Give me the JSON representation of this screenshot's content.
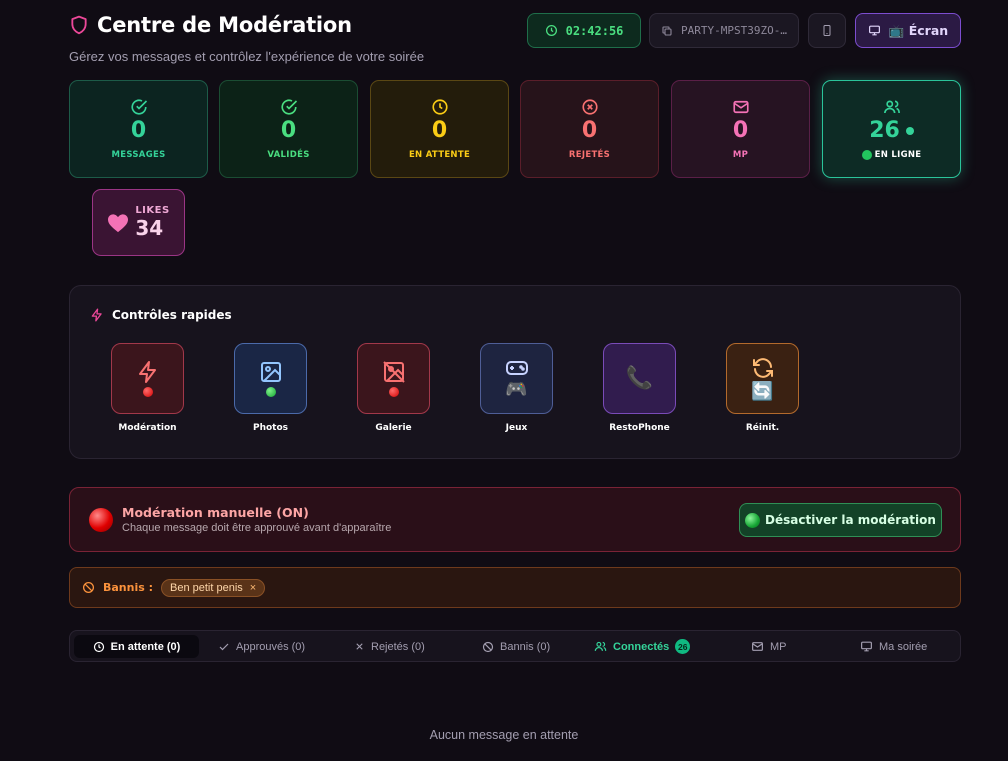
{
  "header": {
    "title": "Centre de Modération",
    "subtitle": "Gérez vos messages et contrôlez l'expérience de votre soirée",
    "timer": "02:42:56",
    "party_code": "PARTY-MPST39ZO-…",
    "screen_button": "📺 Écran"
  },
  "stats": {
    "messages": {
      "value": "0",
      "label": "MESSAGES"
    },
    "validated": {
      "value": "0",
      "label": "VALIDÉS"
    },
    "pending": {
      "value": "0",
      "label": "EN ATTENTE"
    },
    "rejected": {
      "value": "0",
      "label": "REJETÉS"
    },
    "mp": {
      "value": "0",
      "label": "MP"
    },
    "online": {
      "value": "26",
      "label": "EN LIGNE"
    },
    "likes": {
      "value": "34",
      "label": "LIKES"
    }
  },
  "quick_controls": {
    "title": "Contrôles rapides",
    "items": [
      {
        "label": "Modération",
        "status": "off"
      },
      {
        "label": "Photos",
        "status": "on"
      },
      {
        "label": "Galerie",
        "status": "off"
      },
      {
        "label": "Jeux",
        "emoji": "🎮"
      },
      {
        "label": "RestoPhone",
        "emoji": "📞"
      },
      {
        "label": "Réinit.",
        "emoji": "🔄"
      }
    ]
  },
  "moderation": {
    "title": "Modération manuelle (ON)",
    "description": "Chaque message doit être approuvé avant d'apparaître",
    "button": "Désactiver la modération"
  },
  "banned": {
    "label": "Bannis :",
    "users": [
      "Ben petit penis"
    ],
    "remove": "×"
  },
  "tabs": [
    {
      "label": "En attente (0)",
      "icon": "clock-icon",
      "active": true
    },
    {
      "label": "Approuvés (0)",
      "icon": "check-icon"
    },
    {
      "label": "Rejetés (0)",
      "icon": "x-icon"
    },
    {
      "label": "Bannis (0)",
      "icon": "ban-icon"
    },
    {
      "label": "Connectés",
      "icon": "users-icon",
      "badge": "26"
    },
    {
      "label": "MP",
      "icon": "mail-icon"
    },
    {
      "label": "Ma soirée",
      "icon": "monitor-icon"
    }
  ],
  "empty_state": "Aucun message en attente",
  "colors": {
    "background": "#100c14",
    "accent_pink": "#ec4899",
    "green": "#34d399",
    "red": "#f87171",
    "yellow": "#facc15"
  }
}
